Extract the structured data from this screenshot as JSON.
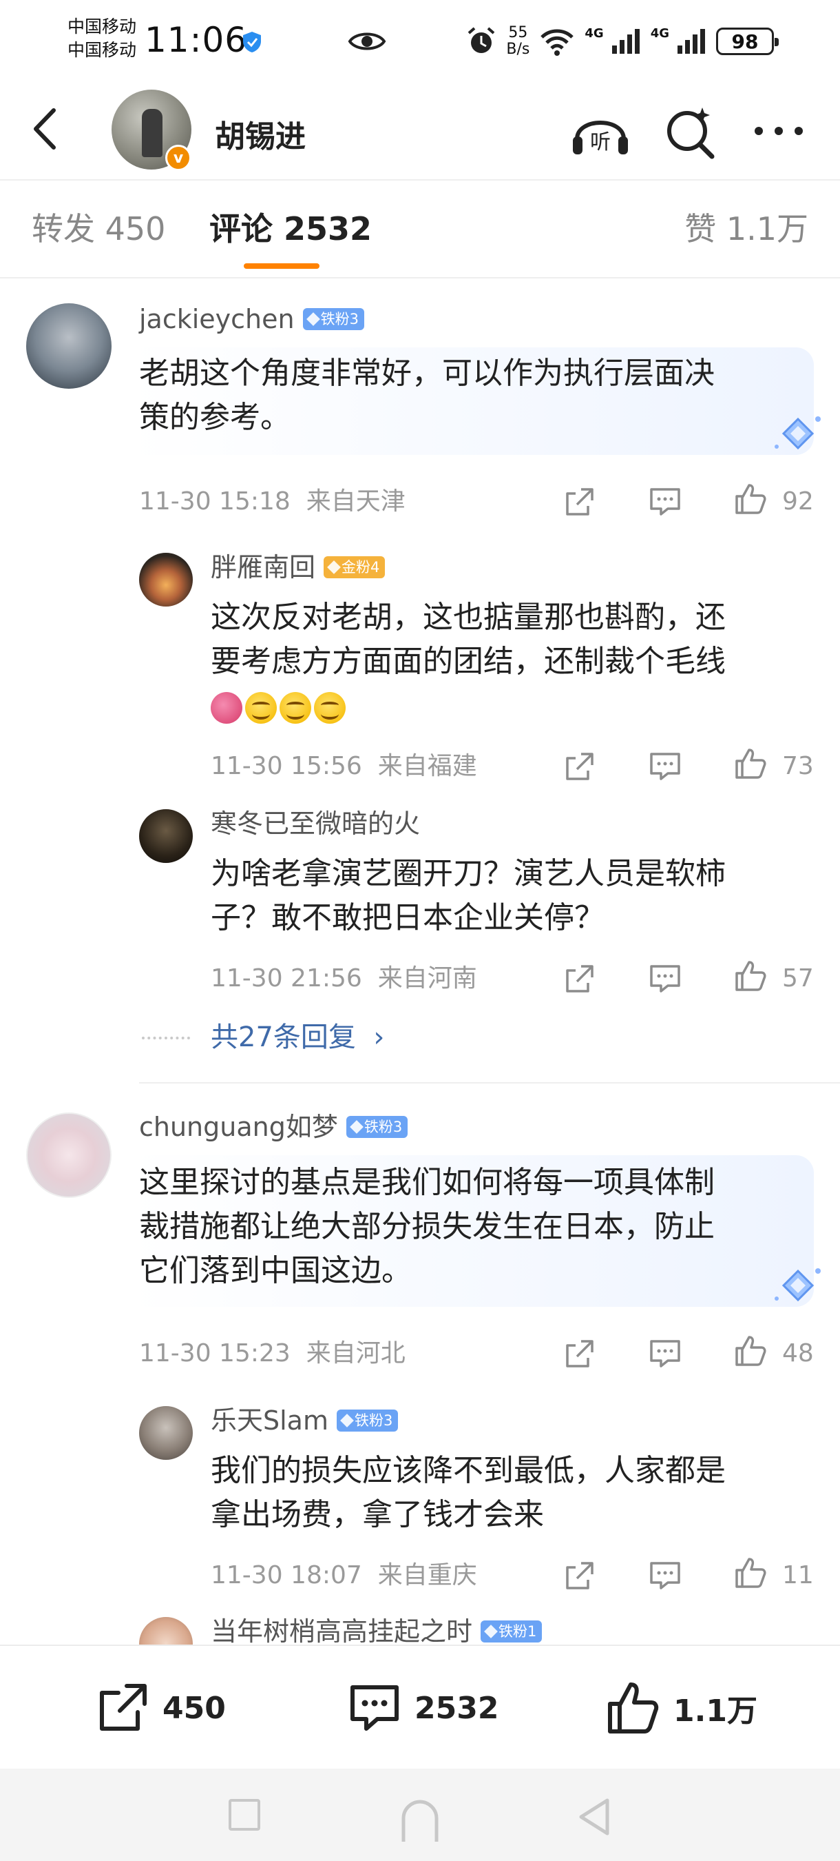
{
  "status_bar": {
    "carrier1": "中国移动",
    "carrier2": "中国移动",
    "time": "11:06",
    "speed_value": "55",
    "speed_unit": "B/s",
    "sig1": "4G",
    "sig2": "4G",
    "battery": "98"
  },
  "header": {
    "user_name": "胡锡进",
    "verified_badge": "v",
    "listen_label": "听",
    "icons": [
      "back-arrow-icon",
      "listen-icon",
      "search-icon",
      "more-icon"
    ]
  },
  "tabs": [
    {
      "label": "转发 450"
    },
    {
      "label": "评论 2532",
      "active": true
    },
    {
      "label": "赞 1.1万"
    }
  ],
  "comments": [
    {
      "user": "jackieychen",
      "badge": "铁粉3",
      "text_lines": [
        "老胡这个角度非常好，可以作为执行层面决",
        "策的参考。"
      ],
      "time": "11-30 15:18",
      "location": "来自天津",
      "likes": "92",
      "replies": [
        {
          "user": "胖雁南回",
          "badge": "金粉4",
          "text_lines": [
            "这次反对老胡，这也掂量那也斟酌，还",
            "要考虑方方面面的团结，还制裁个毛线"
          ],
          "time": "11-30 15:56",
          "location": "来自福建",
          "likes": "73"
        },
        {
          "user": "寒冬已至微暗的火",
          "text_lines": [
            "为啥老拿演艺圈开刀？演艺人员是软柿",
            "子？敢不敢把日本企业关停？"
          ],
          "time": "11-30 21:56",
          "location": "来自河南",
          "likes": "57"
        }
      ],
      "more_replies": "共27条回复"
    },
    {
      "user": "chunguang如梦",
      "badge": "铁粉3",
      "text_lines": [
        "这里探讨的基点是我们如何将每一项具体制",
        "裁措施都让绝大部分损失发生在日本，防止",
        "它们落到中国这边。"
      ],
      "time": "11-30 15:23",
      "location": "来自河北",
      "likes": "48",
      "replies": [
        {
          "user": "乐天Slam",
          "badge": "铁粉3",
          "text_lines": [
            "我们的损失应该降不到最低，人家都是",
            "拿出场费，拿了钱才会来"
          ],
          "time": "11-30 18:07",
          "location": "来自重庆",
          "likes": "11"
        },
        {
          "user": "当年树梢高高挂起之时",
          "badge": "铁粉1"
        }
      ]
    }
  ],
  "bottom_bar": {
    "repost_count": "450",
    "comment_count": "2532",
    "like_count": "1.1万"
  },
  "colors": {
    "accent": "#ff8200",
    "link": "#3f6aa9",
    "fan_badge": "#6aa3f5",
    "gold_badge": "#f5b23b",
    "muted": "#9a9a9a"
  }
}
